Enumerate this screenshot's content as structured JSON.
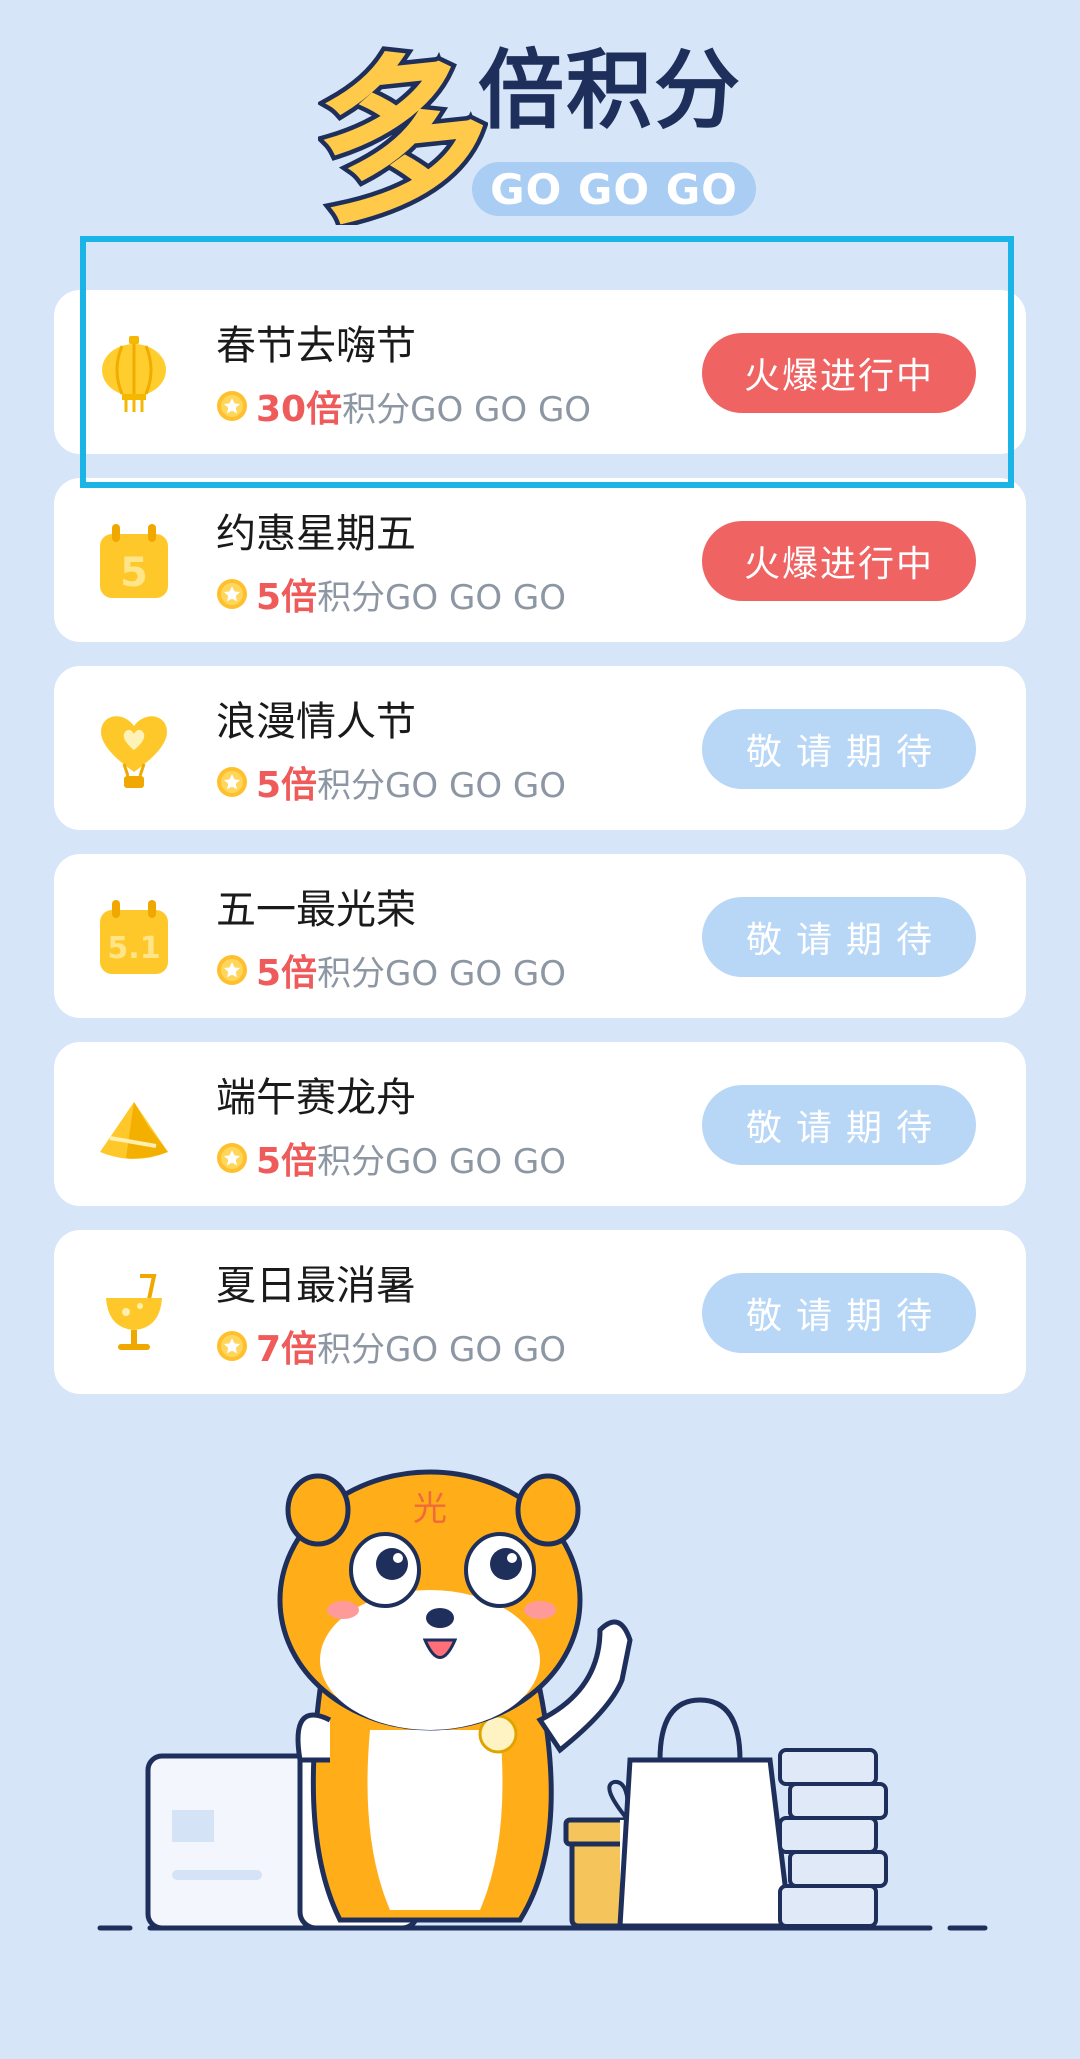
{
  "header": {
    "title_big_char": "多",
    "title_main": "倍积分",
    "title_sub": "GO GO GO"
  },
  "colors": {
    "background": "#d6e6f8",
    "hot_status": "#ef6363",
    "soon_status": "#b8d7f6",
    "multiplier_text": "#ef5a5a",
    "highlight_border": "#1bb4e6"
  },
  "activities": [
    {
      "name": "春节去嗨节",
      "multiplier": "30倍",
      "suffix": "积分GO GO GO",
      "status": "火爆进行中",
      "state": "active",
      "icon": "lantern-icon"
    },
    {
      "name": "约惠星期五",
      "multiplier": "5倍",
      "suffix": "积分GO GO GO",
      "status": "火爆进行中",
      "state": "active",
      "icon": "calendar-5-icon"
    },
    {
      "name": "浪漫情人节",
      "multiplier": "5倍",
      "suffix": "积分GO GO GO",
      "status": "敬请期待",
      "state": "upcoming",
      "icon": "heart-balloon-icon"
    },
    {
      "name": "五一最光荣",
      "multiplier": "5倍",
      "suffix": "积分GO GO GO",
      "status": "敬请期待",
      "state": "upcoming",
      "icon": "calendar-5-1-icon"
    },
    {
      "name": "端午赛龙舟",
      "multiplier": "5倍",
      "suffix": "积分GO GO GO",
      "status": "敬请期待",
      "state": "upcoming",
      "icon": "zongzi-icon"
    },
    {
      "name": "夏日最消暑",
      "multiplier": "7倍",
      "suffix": "积分GO GO GO",
      "status": "敬请期待",
      "state": "upcoming",
      "icon": "drink-glass-icon"
    }
  ],
  "mascot": {
    "forehead_text": "光"
  }
}
